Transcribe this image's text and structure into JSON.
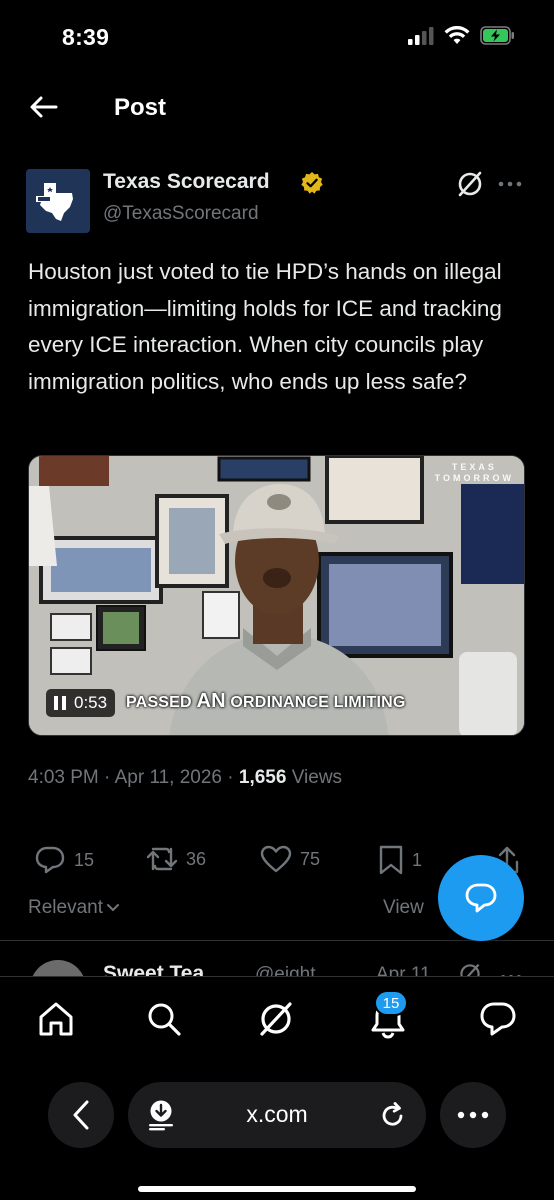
{
  "status_bar": {
    "time": "8:39"
  },
  "header": {
    "title": "Post"
  },
  "post": {
    "author_name": "Texas Scorecard",
    "author_handle": "@TexasScorecard",
    "text": "Houston just voted to tie HPD’s hands on illegal immigration—limiting holds for ICE and tracking every ICE interaction. When city councils play immigration politics, who ends up less safe?",
    "video": {
      "time": "0:53",
      "caption_a": "PASSED ",
      "caption_b": "AN",
      "caption_c": " ORDINANCE LIMITING",
      "watermark_line1": "TEXAS",
      "watermark_line2": "TOMORROW"
    },
    "timestamp": "4:03 PM · Apr 11, 2026 · ",
    "views_count": "1,656",
    "views_label": " Views"
  },
  "actions": {
    "replies": "15",
    "reposts": "36",
    "likes": "75",
    "bookmarks": "1"
  },
  "sort": {
    "label": "Relevant",
    "view_label": "View"
  },
  "reply_preview": {
    "name": "Sweet Tea",
    "handle": "@eight",
    "date": "Apr 11"
  },
  "tab_bar": {
    "notifications_badge": "15"
  },
  "browser": {
    "url": "x.com"
  },
  "colors": {
    "accent": "#1d9bf0",
    "muted": "#71767b",
    "text": "#e7e9ea",
    "verified": "#e2b719"
  }
}
